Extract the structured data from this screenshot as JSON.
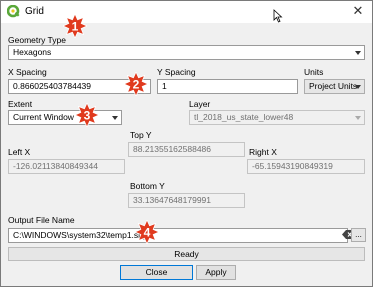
{
  "window": {
    "title": "Grid",
    "close_glyph": "✕"
  },
  "geometry_type": {
    "label": "Geometry Type",
    "value": "Hexagons"
  },
  "spacing": {
    "x_label": "X Spacing",
    "x_value": "0.866025403784439",
    "y_label": "Y Spacing",
    "y_value": "1"
  },
  "units": {
    "label": "Units",
    "value": "Project Units"
  },
  "extent": {
    "label": "Extent",
    "value": "Current Window"
  },
  "layer": {
    "label": "Layer",
    "value": "tl_2018_us_state_lower48"
  },
  "coords": {
    "top_label": "Top Y",
    "top_value": "88.21355162588486",
    "left_label": "Left X",
    "left_value": "-126.02113840849344",
    "right_label": "Right X",
    "right_value": "-65.15943190849319",
    "bottom_label": "Bottom Y",
    "bottom_value": "33.13647648179991"
  },
  "output": {
    "label": "Output File Name",
    "value": "C:\\WINDOWS\\system32\\temp1.shp",
    "browse_label": "..."
  },
  "progress": {
    "status": "Ready",
    "fraction": 0
  },
  "buttons": {
    "close": "Close",
    "apply": "Apply"
  },
  "annotations": [
    {
      "number": "1",
      "color": "#e03a1e"
    },
    {
      "number": "2",
      "color": "#e03a1e"
    },
    {
      "number": "3",
      "color": "#e03a1e"
    },
    {
      "number": "4",
      "color": "#e03a1e"
    }
  ],
  "colors": {
    "app_icon": "#5aa83a",
    "annotation_star": "#e03a1e",
    "focus_border": "#0078d7"
  },
  "icons": {
    "app": "qgis-icon",
    "clear": "clear-text-icon",
    "cursor": "mouse-cursor-icon"
  }
}
